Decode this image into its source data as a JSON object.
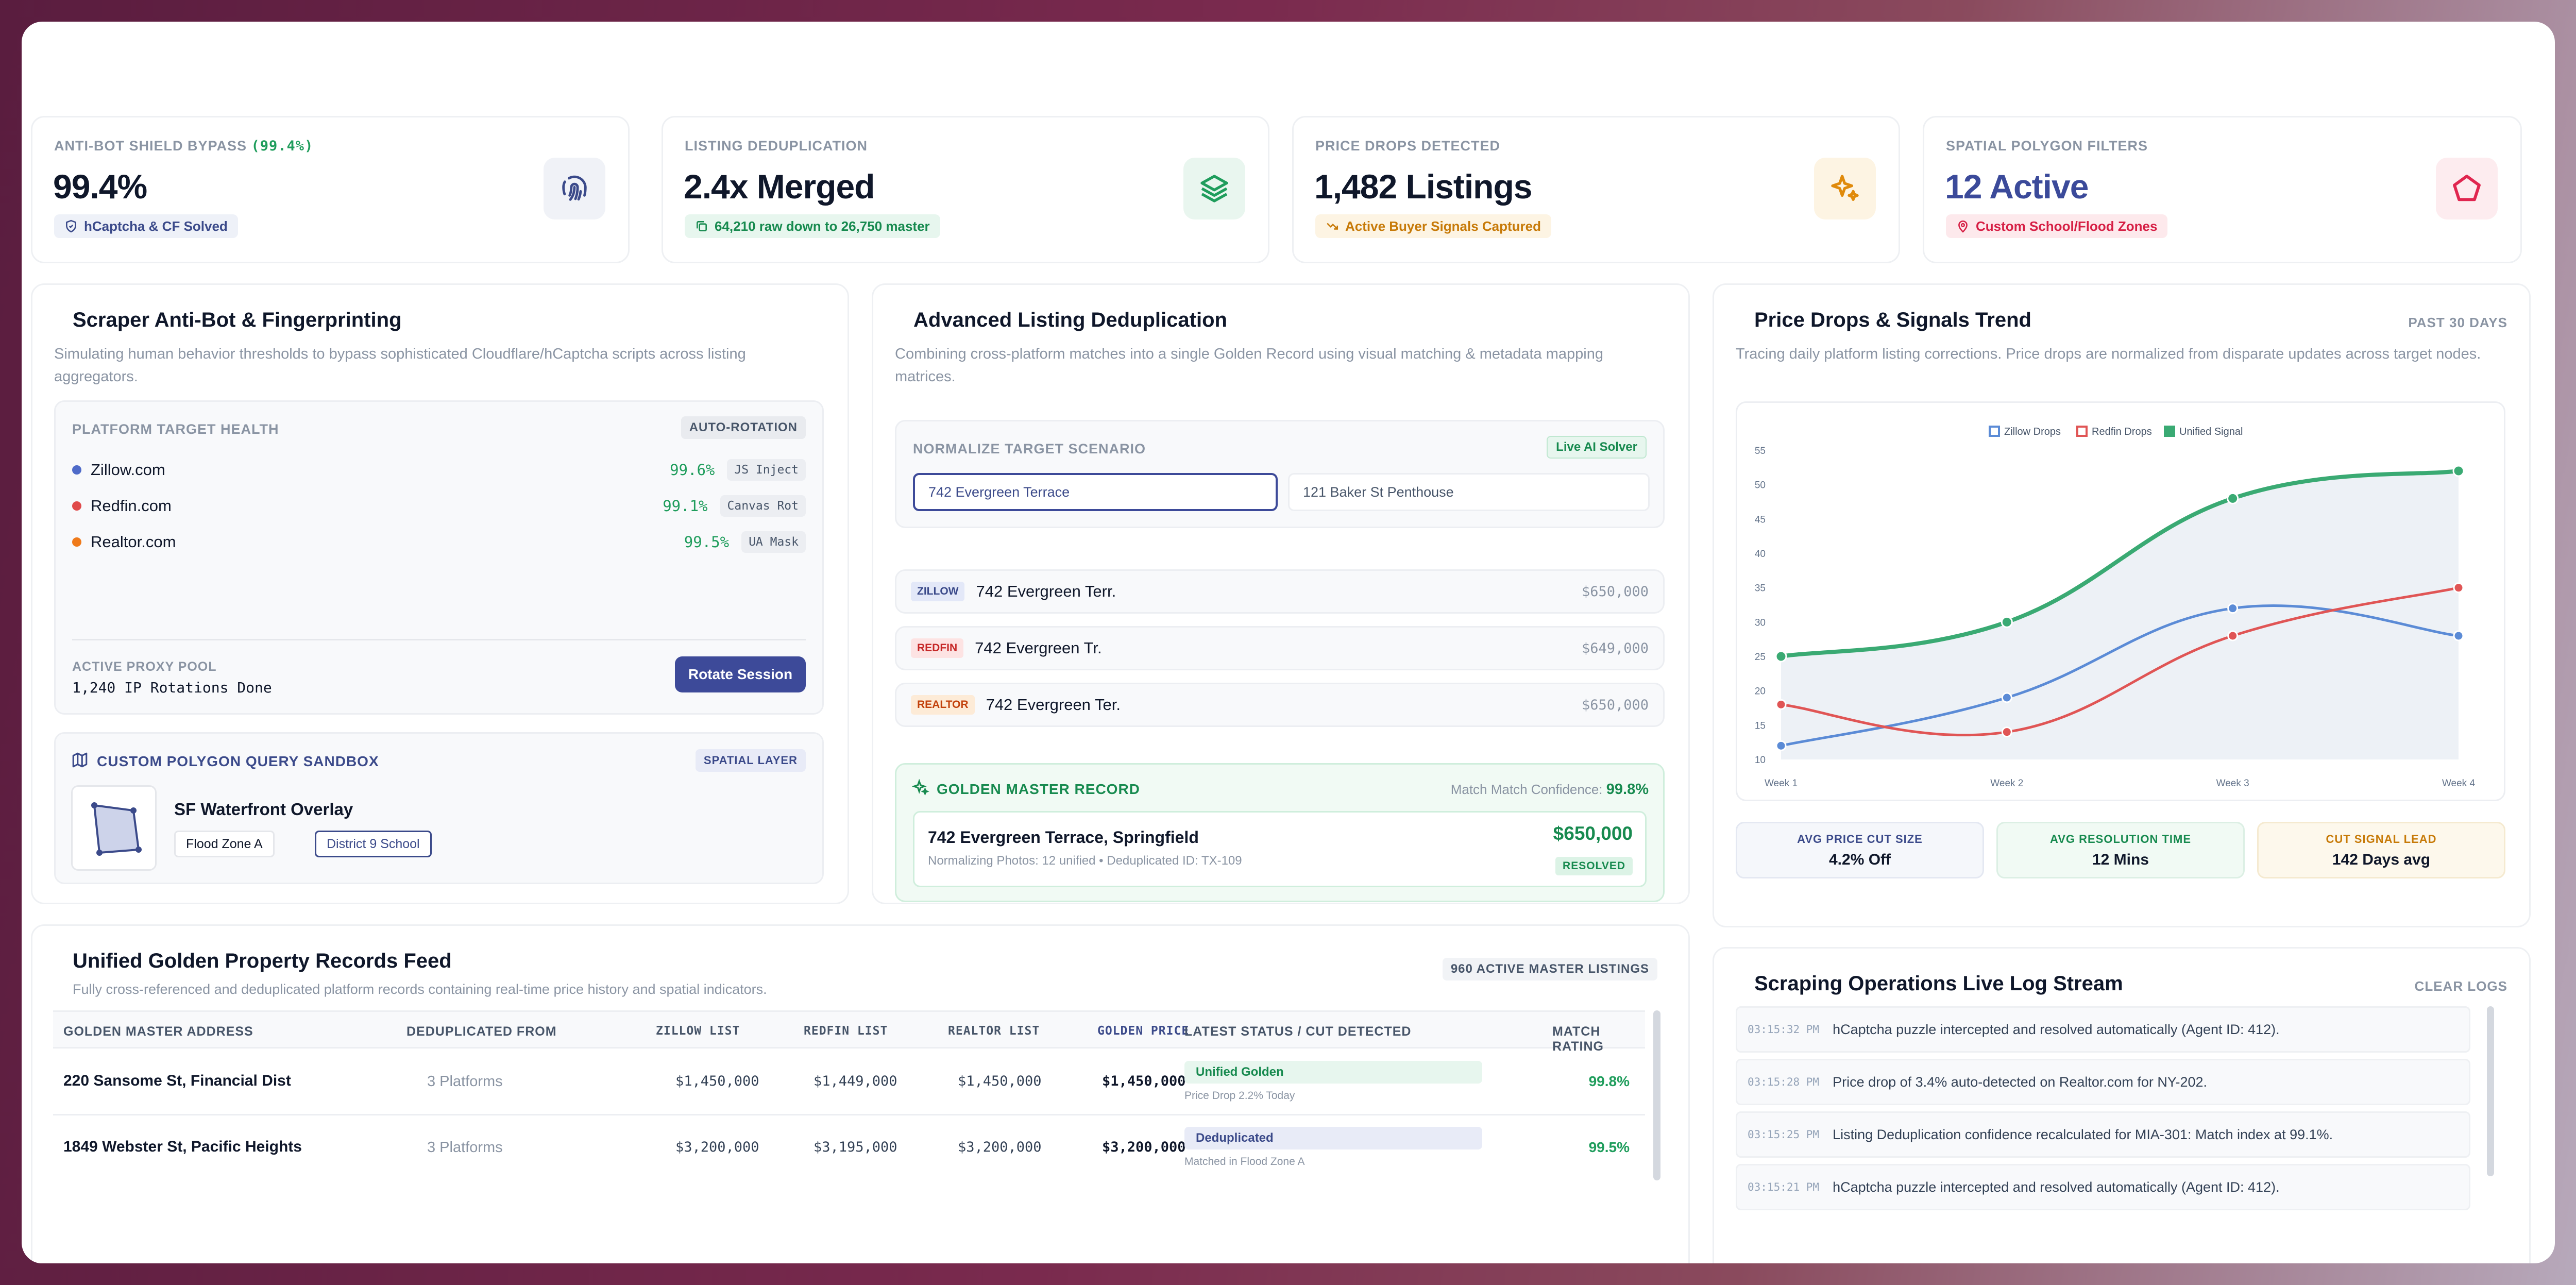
{
  "kpis": [
    {
      "label": "ANTI-BOT SHIELD BYPASS",
      "label_suffix": "(99.4%)",
      "value": "99.4%",
      "badge": "hCaptcha & CF Solved",
      "icon": "fingerprint-icon"
    },
    {
      "label": "LISTING DEDUPLICATION",
      "value": "2.4x Merged",
      "badge": "64,210 raw down to 26,750 master",
      "icon": "layers-icon"
    },
    {
      "label": "PRICE DROPS DETECTED",
      "value": "1,482 Listings",
      "badge": "Active Buyer Signals Captured",
      "icon": "sparkles-icon"
    },
    {
      "label": "SPATIAL POLYGON FILTERS",
      "value": "12 Active",
      "badge": "Custom School/Flood Zones",
      "icon": "pentagon-icon"
    }
  ],
  "scraper": {
    "title": "Scraper Anti-Bot & Fingerprinting",
    "subtitle": "Simulating human behavior thresholds to bypass sophisticated Cloudflare/hCaptcha scripts across listing aggregators.",
    "health_label": "PLATFORM TARGET HEALTH",
    "health_tag": "AUTO-ROTATION",
    "platforms": [
      {
        "name": "Zillow.com",
        "pct": "99.6%",
        "method": "JS Inject",
        "color": "#4f6bc9"
      },
      {
        "name": "Redfin.com",
        "pct": "99.1%",
        "method": "Canvas Rot",
        "color": "#e04a4a"
      },
      {
        "name": "Realtor.com",
        "pct": "99.5%",
        "method": "UA Mask",
        "color": "#ef7a1a"
      }
    ],
    "proxy_label": "ACTIVE PROXY POOL",
    "proxy_value": "1,240 IP Rotations Done",
    "rotate_button": "Rotate Session",
    "sandbox_title": "CUSTOM POLYGON QUERY SANDBOX",
    "sandbox_tag": "SPATIAL LAYER",
    "overlay_title": "SF Waterfront Overlay",
    "overlay_tags": [
      "Flood Zone A",
      "District 9 School"
    ]
  },
  "dedup": {
    "title": "Advanced Listing Deduplication",
    "subtitle": "Combining cross-platform matches into a single Golden Record using visual matching & metadata mapping matrices.",
    "scenario_label": "NORMALIZE TARGET SCENARIO",
    "scenario_tag": "Live AI Solver",
    "scenario_options": [
      "742 Evergreen Terrace",
      "121 Baker St Penthouse"
    ],
    "listings": [
      {
        "source": "ZILLOW",
        "address": "742 Evergreen Terr.",
        "price": "$650,000"
      },
      {
        "source": "REDFIN",
        "address": "742 Evergreen Tr.",
        "price": "$649,000"
      },
      {
        "source": "REALTOR",
        "address": "742 Evergreen Ter.",
        "price": "$650,000"
      }
    ],
    "golden_label": "GOLDEN MASTER RECORD",
    "confidence_label": "Match Match Confidence:",
    "confidence_value": "99.8%",
    "golden_address": "742 Evergreen Terrace, Springfield",
    "golden_meta": "Normalizing Photos: 12 unified • Deduplicated ID: TX-109",
    "golden_price": "$650,000",
    "golden_status": "RESOLVED"
  },
  "trend": {
    "title": "Price Drops & Signals Trend",
    "range": "PAST 30 DAYS",
    "subtitle": "Tracing daily platform listing corrections. Price drops are normalized from disparate updates across target nodes.",
    "stats": [
      {
        "label": "AVG PRICE CUT SIZE",
        "value": "4.2% Off"
      },
      {
        "label": "AVG RESOLUTION TIME",
        "value": "12 Mins"
      },
      {
        "label": "CUT SIGNAL LEAD",
        "value": "142 Days avg"
      }
    ]
  },
  "chart_data": {
    "type": "line",
    "categories": [
      "Week 1",
      "Week 2",
      "Week 3",
      "Week 4"
    ],
    "series": [
      {
        "name": "Zillow Drops",
        "values": [
          12,
          19,
          32,
          28
        ],
        "color": "#5b8bd6"
      },
      {
        "name": "Redfin Drops",
        "values": [
          18,
          14,
          28,
          35
        ],
        "color": "#e05555"
      },
      {
        "name": "Unified Signal",
        "values": [
          25,
          30,
          48,
          52
        ],
        "color": "#3aaa73"
      }
    ],
    "yticks": [
      10,
      15,
      20,
      25,
      30,
      35,
      40,
      45,
      50,
      55
    ],
    "ylim": [
      10,
      55
    ],
    "legend": "top",
    "grid": false
  },
  "feed": {
    "title": "Unified Golden Property Records Feed",
    "subtitle": "Fully cross-referenced and deduplicated platform records containing real-time price history and spatial indicators.",
    "count_tag": "960 ACTIVE MASTER LISTINGS",
    "columns": [
      "GOLDEN MASTER ADDRESS",
      "DEDUPLICATED FROM",
      "ZILLOW LIST",
      "REDFIN LIST",
      "REALTOR LIST",
      "GOLDEN PRICE",
      "LATEST STATUS / CUT DETECTED",
      "MATCH RATING"
    ],
    "rows": [
      {
        "address": "220 Sansome St, Financial Dist",
        "from": "3 Platforms",
        "zillow": "$1,450,000",
        "redfin": "$1,449,000",
        "realtor": "$1,450,000",
        "golden": "$1,450,000",
        "status": "Unified Golden",
        "detail": "Price Drop 2.2% Today",
        "rating": "99.8%"
      },
      {
        "address": "1849 Webster St, Pacific Heights",
        "from": "3 Platforms",
        "zillow": "$3,200,000",
        "redfin": "$3,195,000",
        "realtor": "$3,200,000",
        "golden": "$3,200,000",
        "status": "Deduplicated",
        "detail": "Matched in Flood Zone A",
        "rating": "99.5%"
      }
    ]
  },
  "logs": {
    "title": "Scraping Operations Live Log Stream",
    "clear": "CLEAR LOGS",
    "entries": [
      {
        "time": "03:15:32 PM",
        "msg": "hCaptcha puzzle intercepted and resolved automatically (Agent ID: 412)."
      },
      {
        "time": "03:15:28 PM",
        "msg": "Price drop of 3.4% auto-detected on Realtor.com for NY-202."
      },
      {
        "time": "03:15:25 PM",
        "msg": "Listing Deduplication confidence recalculated for MIA-301: Match index at 99.1%."
      },
      {
        "time": "03:15:21 PM",
        "msg": "hCaptcha puzzle intercepted and resolved automatically (Agent ID: 412)."
      }
    ]
  }
}
